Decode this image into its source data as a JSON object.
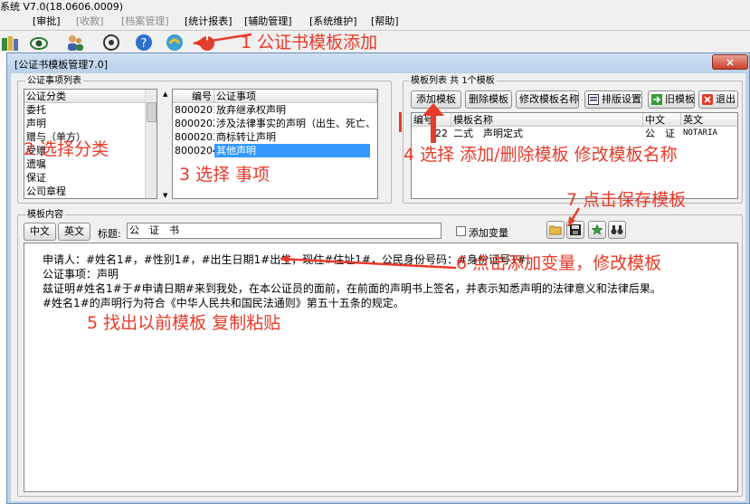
{
  "app": {
    "title": "系统 V7.0(18.0606.0009)"
  },
  "menubar": [
    {
      "label": "[审批]",
      "disabled": false
    },
    {
      "label": "[收款]",
      "disabled": true
    },
    {
      "label": "[档案管理]",
      "disabled": true
    },
    {
      "label": "[统计报表]",
      "disabled": false
    },
    {
      "label": "[辅助管理]",
      "disabled": false
    },
    {
      "label": "[系统维护]",
      "disabled": false
    },
    {
      "label": "[帮助]",
      "disabled": false
    }
  ],
  "toolbar_labels": [
    "退出",
    "帮助",
    "关于"
  ],
  "dialog": {
    "title": "[公证书模板管理7.0]",
    "close_label": "×"
  },
  "category_group": {
    "label": "公证事项列表",
    "header": "公证分类",
    "items": [
      "委托",
      "声明",
      "赠与（单方）",
      "受赠",
      "遗嘱",
      "保证",
      "公司章程"
    ]
  },
  "matter_list": {
    "headers": [
      "编号",
      "公证事项"
    ],
    "rows": [
      {
        "code": "8000201",
        "name": "放弃继承权声明"
      },
      {
        "code": "8000202",
        "name": "涉及法律事实的声明（出生、死亡、"
      },
      {
        "code": "8000203",
        "name": "商标转让声明"
      },
      {
        "code": "8000204",
        "name": "其他声明"
      }
    ]
  },
  "template_group": {
    "label": "模板列表 共 1个模板",
    "buttons": {
      "add": "添加模板",
      "delete": "删除模板",
      "rename": "修改模板名称",
      "layout": "排版设置",
      "old": "旧模板",
      "exit": "退出"
    },
    "headers": [
      "编号",
      "模板名称",
      "中文",
      "英文"
    ],
    "rows": [
      {
        "code": "22",
        "name": "二式　声明定式",
        "zh": "公　证",
        "en": "NOTARIA"
      }
    ]
  },
  "content_group": {
    "label": "模板内容",
    "tab_zh": "中文",
    "tab_en": "英文",
    "title_label": "标题:",
    "title_value": "公　证　书",
    "add_variable_label": "添加变量",
    "lines": [
      "申请人：#姓名1#，#性别1#，#出生日期1#出生，现住#住址1#，公民身份号码：#身份证号1#。",
      "公证事项：声明",
      "兹证明#姓名1#于#申请日期#来到我处，在本公证员的面前，在前面的声明书上签名，并表示知悉声明的法律意义和法律后果。",
      "#姓名1#的声明行为符合《中华人民共和国民法通则》第五十五条的规定。"
    ]
  },
  "annotations": {
    "a1": "1 公证书模板添加",
    "a2": "2 选择分类",
    "a3": "3 选择 事项",
    "a4": "4 选择 添加/删除模板 修改模板名称",
    "a5": "5 找出以前模板 复制粘贴",
    "a6": "6 点击添加变量，修改模板",
    "a7": "7 点击保存模板"
  },
  "colors": {
    "annotation": "#e83a2a",
    "selection": "#3399ff",
    "dialog_frame": "#bcd3ea"
  }
}
